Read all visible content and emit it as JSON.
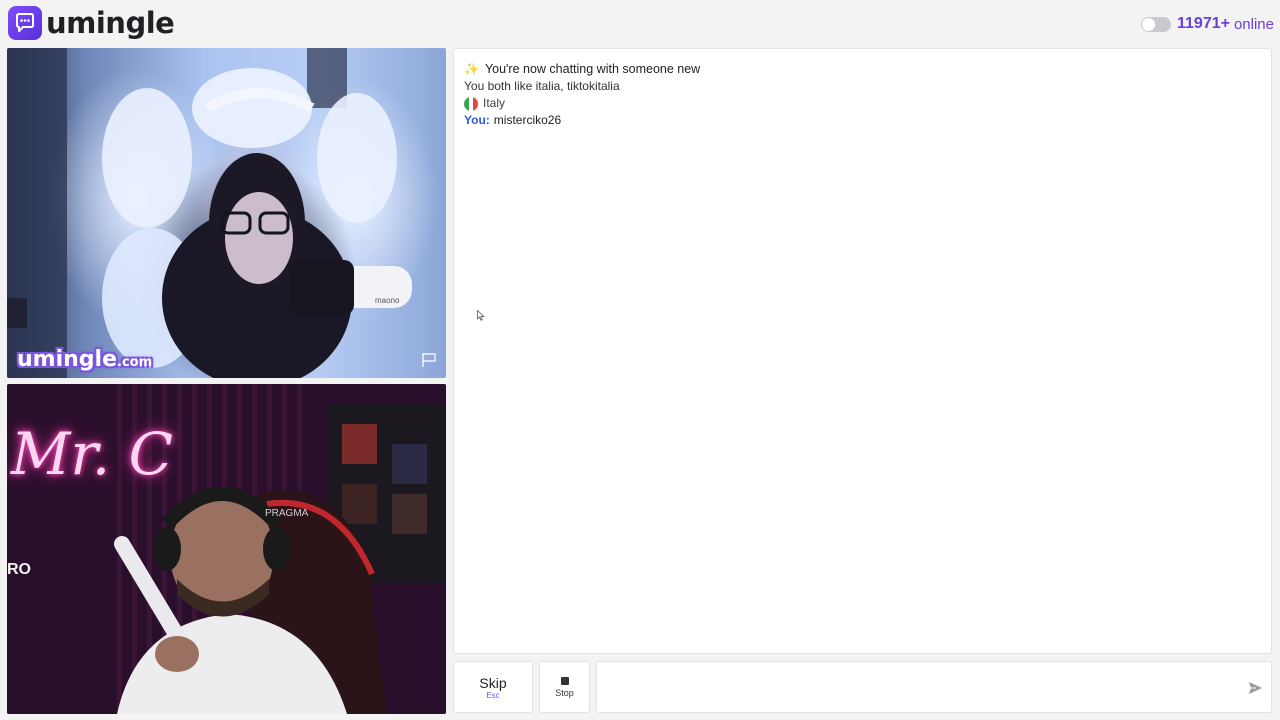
{
  "header": {
    "logo_text": "umingle",
    "online_count": "11971+",
    "online_label": "online"
  },
  "videos": {
    "stranger_watermark_main": "umingle",
    "stranger_watermark_suffix": ".com",
    "self_neon_sign": "Mr. C"
  },
  "chat": {
    "intro": "You're now chatting with someone new",
    "common_interests": "You both like italia, tiktokitalia",
    "country": "Italy",
    "messages": [
      {
        "sender": "You:",
        "text": "misterciko26"
      }
    ]
  },
  "controls": {
    "skip_label": "Skip",
    "skip_hint": "Esc",
    "stop_label": "Stop",
    "message_placeholder": ""
  },
  "colors": {
    "accent": "#6a3fd8",
    "you_label": "#2d5bd8",
    "italy_flag": [
      "#3aa655",
      "#ffffff",
      "#e8463f"
    ]
  },
  "icons": {
    "logo": "chat-bubble-icon",
    "report": "flag-icon",
    "send": "send-arrow-icon",
    "stop": "stop-square-icon"
  }
}
